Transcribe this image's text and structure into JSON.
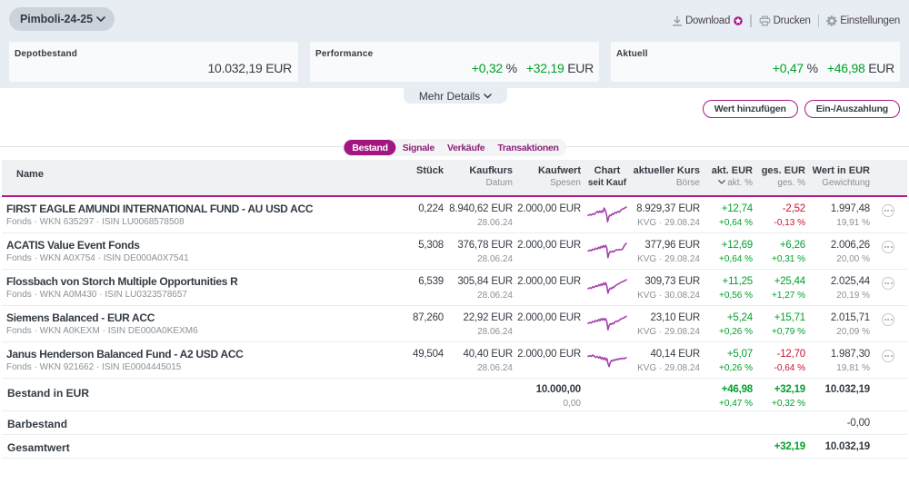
{
  "topbar": {
    "portfolio_selector": "Pimboli-24-25",
    "download_label": "Download",
    "print_label": "Drucken",
    "settings_label": "Einstellungen"
  },
  "summary_cards": {
    "depotbestand": {
      "label": "Depotbestand",
      "value": "10.032,19 EUR"
    },
    "performance": {
      "label": "Performance",
      "percent": "+0,32",
      "percent_unit": "%",
      "amount": "+32,19",
      "amount_unit": "EUR"
    },
    "aktuell": {
      "label": "Aktuell",
      "percent": "+0,47",
      "percent_unit": "%",
      "amount": "+46,98",
      "amount_unit": "EUR"
    }
  },
  "mehr_details_label": "Mehr Details",
  "action_buttons": {
    "add_value": "Wert hinzufügen",
    "deposit_withdraw": "Ein-/Auszahlung"
  },
  "tabs": [
    {
      "label": "Bestand",
      "active": true
    },
    {
      "label": "Signale",
      "active": false
    },
    {
      "label": "Verkäufe",
      "active": false
    },
    {
      "label": "Transaktionen",
      "active": false
    }
  ],
  "table": {
    "headers": {
      "name": "Name",
      "stueck": "Stück",
      "kaufkurs": "Kaufkurs",
      "kaufkurs2": "Datum",
      "kaufwert": "Kaufwert",
      "kaufwert2": "Spesen",
      "chart": "Chart",
      "chart2": "seit Kauf",
      "kurs": "aktueller Kurs",
      "kurs2": "Börse",
      "akt": "akt. EUR",
      "akt2": "akt. %",
      "ges": "ges. EUR",
      "ges2": "ges. %",
      "wert": "Wert in EUR",
      "wert2": "Gewichtung"
    },
    "rows": [
      {
        "name": "FIRST EAGLE AMUNDI INTERNATIONAL FUND - AU USD ACC",
        "sub": "Fonds · WKN 635297 · ISIN LU0068578508",
        "stueck": "0,224",
        "kaufkurs": "8.940,62 EUR",
        "kaufdatum": "28.06.24",
        "kaufwert": "2.000,00 EUR",
        "kurs": "8.929,37 EUR",
        "boerse": "KVG · 29.08.24",
        "akt_eur": "+12,74",
        "akt_pct": "+0,64 %",
        "ges_eur": "-2,52",
        "ges_pct": "-0,13 %",
        "wert": "1.997,48",
        "gewichtung": "19,91 %",
        "spark": [
          0,
          62,
          4,
          56,
          8,
          60,
          12,
          52,
          16,
          56,
          20,
          46,
          24,
          38,
          27,
          46,
          30,
          36,
          33,
          44,
          36,
          34,
          39,
          42,
          42,
          18,
          45,
          32,
          48,
          55,
          51,
          100,
          54,
          72,
          57,
          60,
          60,
          64,
          63,
          52,
          66,
          56,
          70,
          44,
          74,
          48,
          78,
          38,
          82,
          42,
          86,
          30,
          90,
          24,
          94,
          20,
          97,
          16,
          100,
          12
        ]
      },
      {
        "name": "ACATIS Value Event Fonds",
        "sub": "Fonds · WKN A0X754 · ISIN DE000A0X7541",
        "stueck": "5,308",
        "kaufkurs": "376,78 EUR",
        "kaufdatum": "28.06.24",
        "kaufwert": "2.000,00 EUR",
        "kurs": "377,96 EUR",
        "boerse": "KVG · 29.08.24",
        "akt_eur": "+12,69",
        "akt_pct": "+0,64 %",
        "ges_eur": "+6,26",
        "ges_pct": "+0,31 %",
        "wert": "2.006,26",
        "gewichtung": "20,00 %",
        "spark": [
          0,
          58,
          4,
          52,
          8,
          56,
          12,
          46,
          16,
          50,
          20,
          40,
          24,
          46,
          28,
          34,
          31,
          42,
          34,
          30,
          37,
          38,
          40,
          26,
          43,
          34,
          46,
          24,
          49,
          40,
          52,
          97,
          55,
          70,
          58,
          60,
          61,
          64,
          64,
          58,
          67,
          62,
          70,
          56,
          74,
          50,
          78,
          52,
          82,
          48,
          86,
          50,
          90,
          46,
          94,
          30,
          97,
          18,
          100,
          12
        ]
      },
      {
        "name": "Flossbach von Storch Multiple Opportunities R",
        "sub": "Fonds · WKN A0M430 · ISIN LU0323578657",
        "stueck": "6,539",
        "kaufkurs": "305,84 EUR",
        "kaufdatum": "28.06.24",
        "kaufwert": "2.000,00 EUR",
        "kurs": "309,73 EUR",
        "boerse": "KVG · 30.08.24",
        "akt_eur": "+11,25",
        "akt_pct": "+0,56 %",
        "ges_eur": "+25,44",
        "ges_pct": "+1,27 %",
        "wert": "2.025,44",
        "gewichtung": "20,19 %",
        "spark": [
          0,
          66,
          4,
          60,
          8,
          64,
          12,
          54,
          16,
          58,
          20,
          48,
          24,
          52,
          28,
          42,
          31,
          48,
          34,
          38,
          37,
          46,
          40,
          32,
          43,
          42,
          46,
          30,
          49,
          50,
          52,
          92,
          55,
          72,
          58,
          62,
          61,
          66,
          64,
          56,
          67,
          60,
          70,
          50,
          74,
          44,
          78,
          38,
          82,
          34,
          86,
          28,
          90,
          24,
          94,
          20,
          97,
          16,
          100,
          12
        ]
      },
      {
        "name": "Siemens Balanced - EUR ACC",
        "sub": "Fonds · WKN A0KEXM · ISIN DE000A0KEXM6",
        "stueck": "87,260",
        "kaufkurs": "22,92 EUR",
        "kaufdatum": "28.06.24",
        "kaufwert": "2.000,00 EUR",
        "kurs": "23,10 EUR",
        "boerse": "KVG · 29.08.24",
        "akt_eur": "+5,24",
        "akt_pct": "+0,26 %",
        "ges_eur": "+15,71",
        "ges_pct": "+0,79 %",
        "wert": "2.015,71",
        "gewichtung": "20,09 %",
        "spark": [
          0,
          56,
          4,
          50,
          8,
          54,
          12,
          44,
          16,
          48,
          20,
          38,
          24,
          44,
          28,
          32,
          31,
          40,
          34,
          28,
          37,
          36,
          40,
          26,
          43,
          36,
          46,
          28,
          49,
          46,
          52,
          94,
          55,
          68,
          58,
          58,
          61,
          62,
          64,
          54,
          67,
          58,
          70,
          48,
          74,
          42,
          78,
          44,
          82,
          36,
          86,
          30,
          90,
          26,
          94,
          22,
          97,
          18,
          100,
          14
        ]
      },
      {
        "name": "Janus Henderson Balanced Fund - A2 USD ACC",
        "sub": "Fonds · WKN 921662 · ISIN IE0004445015",
        "stueck": "49,504",
        "kaufkurs": "40,40 EUR",
        "kaufdatum": "28.06.24",
        "kaufwert": "2.000,00 EUR",
        "kurs": "40,14 EUR",
        "boerse": "KVG · 29.08.24",
        "akt_eur": "+5,07",
        "akt_pct": "+0,26 %",
        "ges_eur": "-12,70",
        "ges_pct": "-0,64 %",
        "wert": "1.987,30",
        "gewichtung": "19,81 %",
        "spark": [
          0,
          36,
          4,
          32,
          8,
          36,
          12,
          28,
          16,
          34,
          20,
          42,
          24,
          36,
          28,
          46,
          31,
          38,
          34,
          50,
          37,
          42,
          40,
          54,
          43,
          44,
          46,
          58,
          49,
          48,
          52,
          78,
          55,
          97,
          58,
          72,
          61,
          60,
          64,
          64,
          67,
          56,
          70,
          60,
          74,
          52,
          78,
          56,
          82,
          48,
          86,
          52,
          90,
          46,
          94,
          50,
          97,
          46,
          100,
          44
        ]
      }
    ],
    "footer": {
      "bestand": {
        "label": "Bestand in EUR",
        "kaufwert": "10.000,00",
        "spesen": "0,00",
        "akt_eur": "+46,98",
        "akt_pct": "+0,47 %",
        "ges_eur": "+32,19",
        "ges_pct": "+0,32 %",
        "wert": "10.032,19"
      },
      "barbestand": {
        "label": "Barbestand",
        "wert": "-0,00"
      },
      "gesamtwert": {
        "label": "Gesamtwert",
        "ges_eur": "+32,19",
        "wert": "10.032,19"
      }
    }
  },
  "colors": {
    "band": "#e7edf2",
    "magenta": "#a91884",
    "green": "#00a12b",
    "red": "#c8132e",
    "dark": "#343b45",
    "gray": "#8b9196",
    "spark": "#a643ae"
  }
}
